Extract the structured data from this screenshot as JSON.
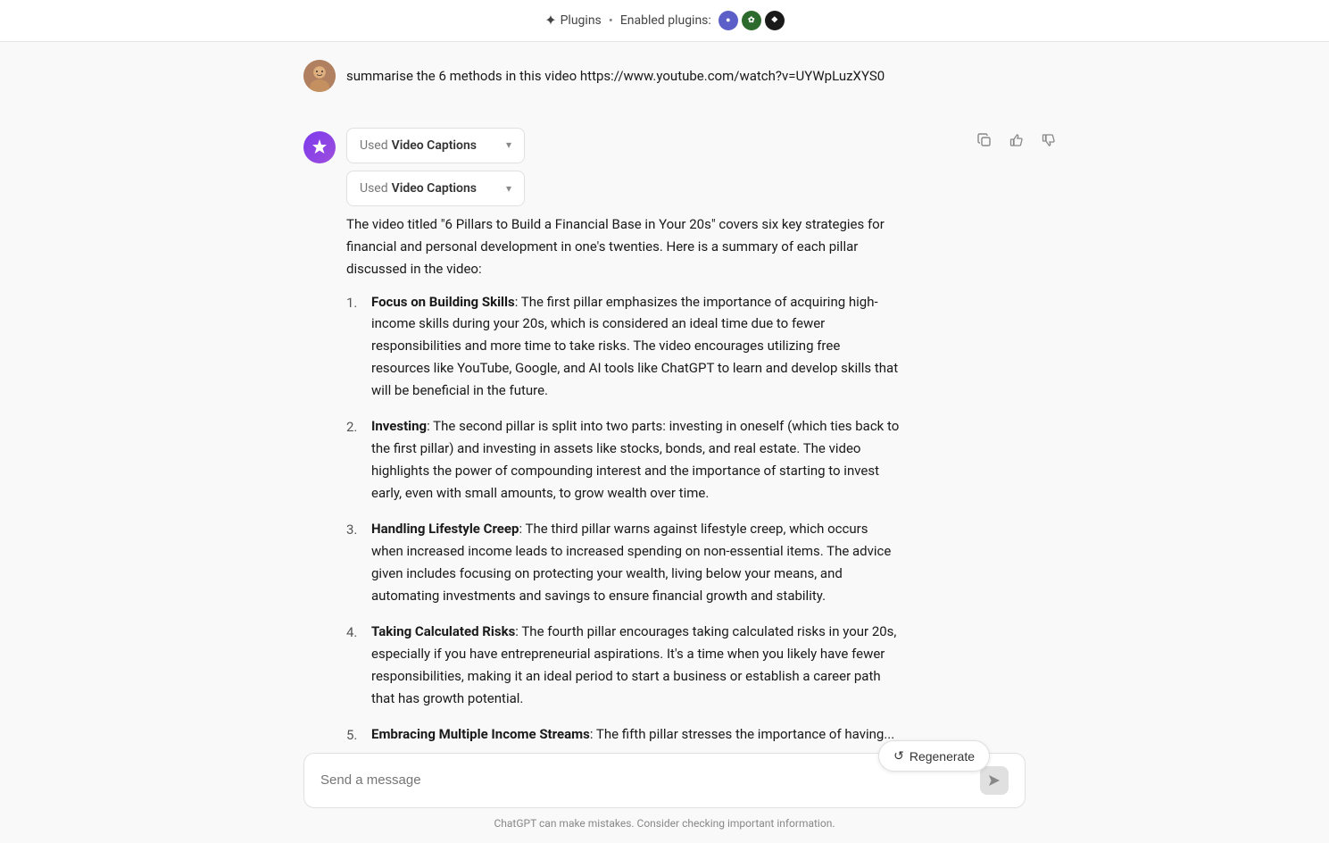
{
  "topbar": {
    "plugins_label": "Plugins",
    "separator": "•",
    "enabled_label": "Enabled plugins:",
    "badges": [
      {
        "id": "badge-blue",
        "color": "#5b5fc7",
        "symbol": "⬤"
      },
      {
        "id": "badge-green",
        "color": "#2d7d2d",
        "symbol": "⬤"
      },
      {
        "id": "badge-dark",
        "color": "#1a1a1a",
        "symbol": "⬤"
      }
    ]
  },
  "user_message": {
    "text": "summarise the 6 methods in this video https://www.youtube.com/watch?v=UYWpLuzXYS0"
  },
  "ai_response": {
    "captions": [
      {
        "label_used": "Used",
        "label_bold": "Video Captions"
      },
      {
        "label_used": "Used",
        "label_bold": "Video Captions"
      }
    ],
    "intro_text": "The video titled \"6 Pillars to Build a Financial Base in Your 20s\" covers six key strategies for financial and personal development in one's twenties. Here is a summary of each pillar discussed in the video:",
    "items": [
      {
        "number": "1.",
        "bold": "Focus on Building Skills",
        "text": ": The first pillar emphasizes the importance of acquiring high-income skills during your 20s, which is considered an ideal time due to fewer responsibilities and more time to take risks. The video encourages utilizing free resources like YouTube, Google, and AI tools like ChatGPT to learn and develop skills that will be beneficial in the future."
      },
      {
        "number": "2.",
        "bold": "Investing",
        "text": ": The second pillar is split into two parts: investing in oneself (which ties back to the first pillar) and investing in assets like stocks, bonds, and real estate. The video highlights the power of compounding interest and the importance of starting to invest early, even with small amounts, to grow wealth over time."
      },
      {
        "number": "3.",
        "bold": "Handling Lifestyle Creep",
        "text": ": The third pillar warns against lifestyle creep, which occurs when increased income leads to increased spending on non-essential items. The advice given includes focusing on protecting your wealth, living below your means, and automating investments and savings to ensure financial growth and stability."
      },
      {
        "number": "4.",
        "bold": "Taking Calculated Risks",
        "text": ": The fourth pillar encourages taking calculated risks in your 20s, especially if you have entrepreneurial aspirations. It's a time when you likely have fewer responsibilities, making it an ideal period to start a business or establish a career path that has growth potential."
      },
      {
        "number": "5.",
        "bold": "Embracing Multiple Income Streams",
        "text": ": The fifth pillar stresses the importance of having..."
      }
    ],
    "actions": {
      "copy": "⧉",
      "thumbup": "👍",
      "thumbdown": "👎"
    }
  },
  "regenerate": {
    "label": "Regenerate",
    "icon": "↺"
  },
  "input": {
    "placeholder": "Send a message",
    "send_icon": "▶"
  },
  "disclaimer": "ChatGPT can make mistakes. Consider checking important information."
}
